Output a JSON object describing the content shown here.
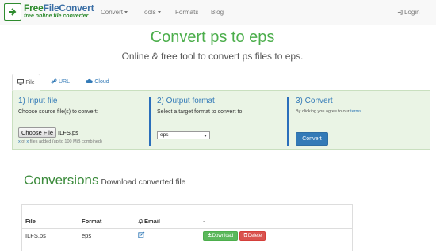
{
  "brand": {
    "title_part1": "Free",
    "title_part2": "FileConvert",
    "tagline": "free online file converter"
  },
  "nav": {
    "items": [
      {
        "label": "Convert",
        "icon": "caret-down-icon"
      },
      {
        "label": "Tools",
        "icon": "caret-down-icon"
      },
      {
        "label": "Formats"
      },
      {
        "label": "Blog"
      }
    ],
    "login_label": "Login"
  },
  "page": {
    "title": "Convert ps to eps",
    "subtitle": "Online & free tool to convert ps files to eps."
  },
  "tabs": [
    {
      "label": "File",
      "icon": "monitor-icon",
      "active": true
    },
    {
      "label": "URL",
      "icon": "link-icon",
      "active": false
    },
    {
      "label": "Cloud",
      "icon": "cloud-icon",
      "active": false
    }
  ],
  "step1": {
    "heading": "1) Input file",
    "hint": "Choose source file(s) to convert:",
    "choose_button": "Choose File",
    "file_name": "ILFS.ps",
    "count_a": "x",
    "count_of": "of",
    "count_b": "x",
    "files_added": "files added (up to 100 MiB combined)"
  },
  "step2": {
    "heading": "2) Output format",
    "hint": "Select a target format to convert to:",
    "selected": "eps"
  },
  "step3": {
    "heading": "3) Convert",
    "agree_text": "By clicking you agree to our",
    "terms_link": "terms",
    "button": "Convert"
  },
  "conversions": {
    "title": "Conversions",
    "subtitle": "Download converted file",
    "headers": {
      "file": "File",
      "format": "Format",
      "email": "Email",
      "action": "-"
    },
    "rows": [
      {
        "file": "ILFS.ps",
        "format": "eps",
        "download": "Download",
        "delete": "Delete"
      }
    ]
  },
  "colors": {
    "brand_green": "#4cae4c",
    "link_blue": "#337ab7",
    "panel_bg": "#eaf4e5",
    "success": "#5cb85c",
    "danger": "#d9534f"
  }
}
